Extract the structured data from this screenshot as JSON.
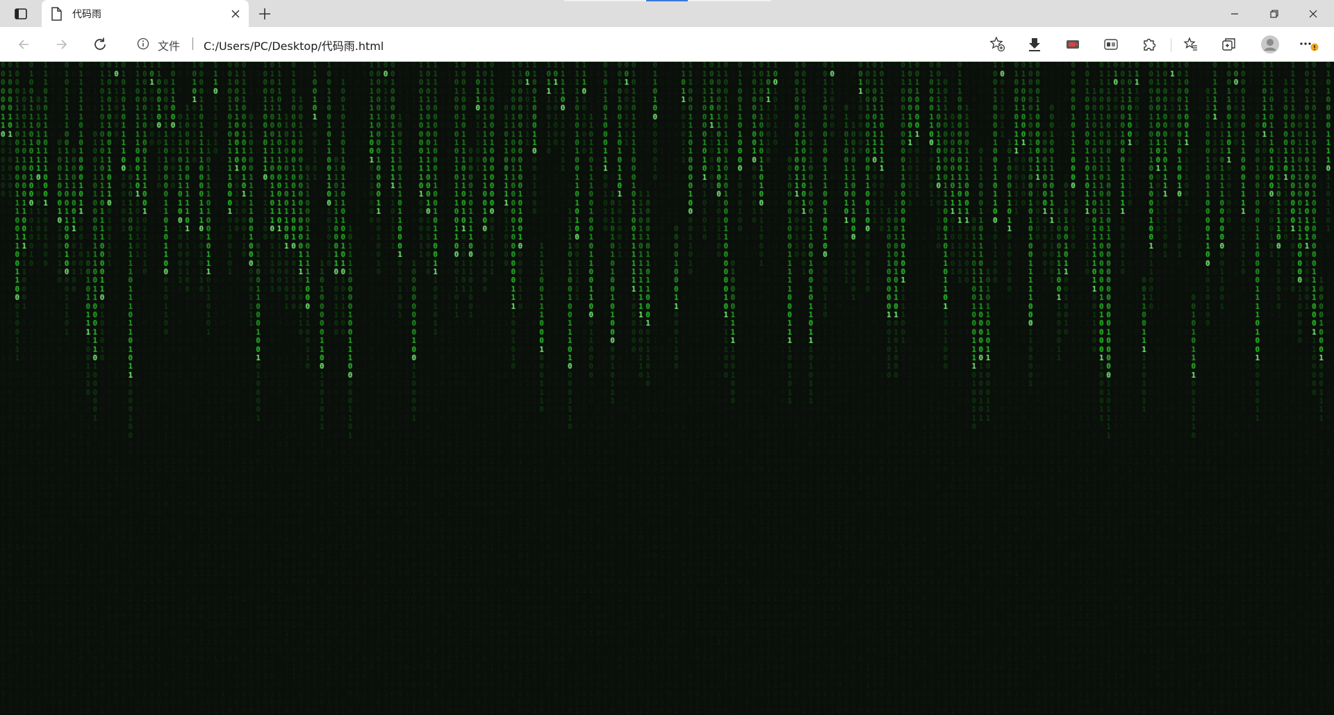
{
  "browser": {
    "tab": {
      "title": "代码雨",
      "icon": "page-icon"
    },
    "new_tab_icon": "plus-icon",
    "window_controls": [
      "minimize-icon",
      "restore-icon",
      "close-icon"
    ]
  },
  "toolbar": {
    "nav": [
      "back-arrow-icon",
      "forward-arrow-icon",
      "refresh-icon"
    ],
    "address": {
      "scheme_label": "文件",
      "url": "C:/Users/PC/Desktop/代码雨.html",
      "info_icon": "info-icon",
      "add_favorite_icon": "star-plus-icon"
    },
    "right_icons": [
      "download-icon",
      "extension-red-icon",
      "workspace-icon",
      "puzzle-icon",
      "favorites-icon",
      "collections-icon",
      "profile-avatar-icon",
      "more-menu-icon"
    ]
  },
  "page": {
    "background_color": "#0b0f0b",
    "glyphs": [
      "0",
      "1"
    ],
    "text_color": "#2ad82a",
    "dim_text_color": "#103810"
  }
}
